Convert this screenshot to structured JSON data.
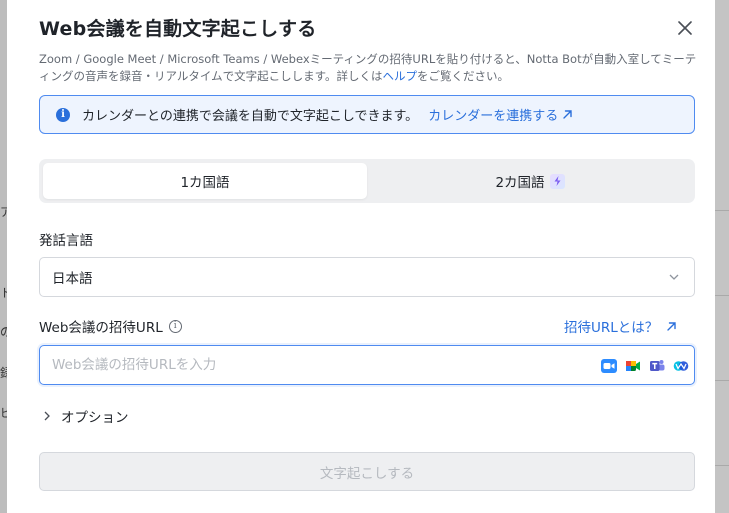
{
  "dialog": {
    "title": "Web会議を自動文字起こしする",
    "description_part1": "Zoom / Google Meet / Microsoft Teams / Webexミーティングの招待URLを貼り付けると、Notta Botが自動入室してミーティングの音声を録音・リアルタイムで文字起こしします。詳しくは",
    "description_link": "ヘルプ",
    "description_part2": "をご覧ください。"
  },
  "banner": {
    "text": "カレンダーとの連携で会議を自動で文字起こしできます。",
    "link": "カレンダーを連携する"
  },
  "language_tabs": [
    {
      "label": "1カ国語",
      "active": true
    },
    {
      "label": "2カ国語",
      "active": false
    }
  ],
  "language": {
    "label": "発話言語",
    "selected": "日本語"
  },
  "url": {
    "label": "Web会議の招待URL",
    "help_link": "招待URLとは？",
    "placeholder": "Web会議の招待URLを入力",
    "value": ""
  },
  "services": [
    "zoom-icon",
    "google-meet-icon",
    "teams-icon",
    "webex-icon"
  ],
  "options_label": "オプション",
  "submit_label": "文字起こしする",
  "colors": {
    "accent": "#2a6fdb",
    "banner_bg": "#eef4fe",
    "disabled_bg": "#eeeff1",
    "disabled_text": "#b5b9bf"
  },
  "background_glyphs": [
    "ア",
    "ト",
    "の",
    "録",
    "ビ"
  ]
}
